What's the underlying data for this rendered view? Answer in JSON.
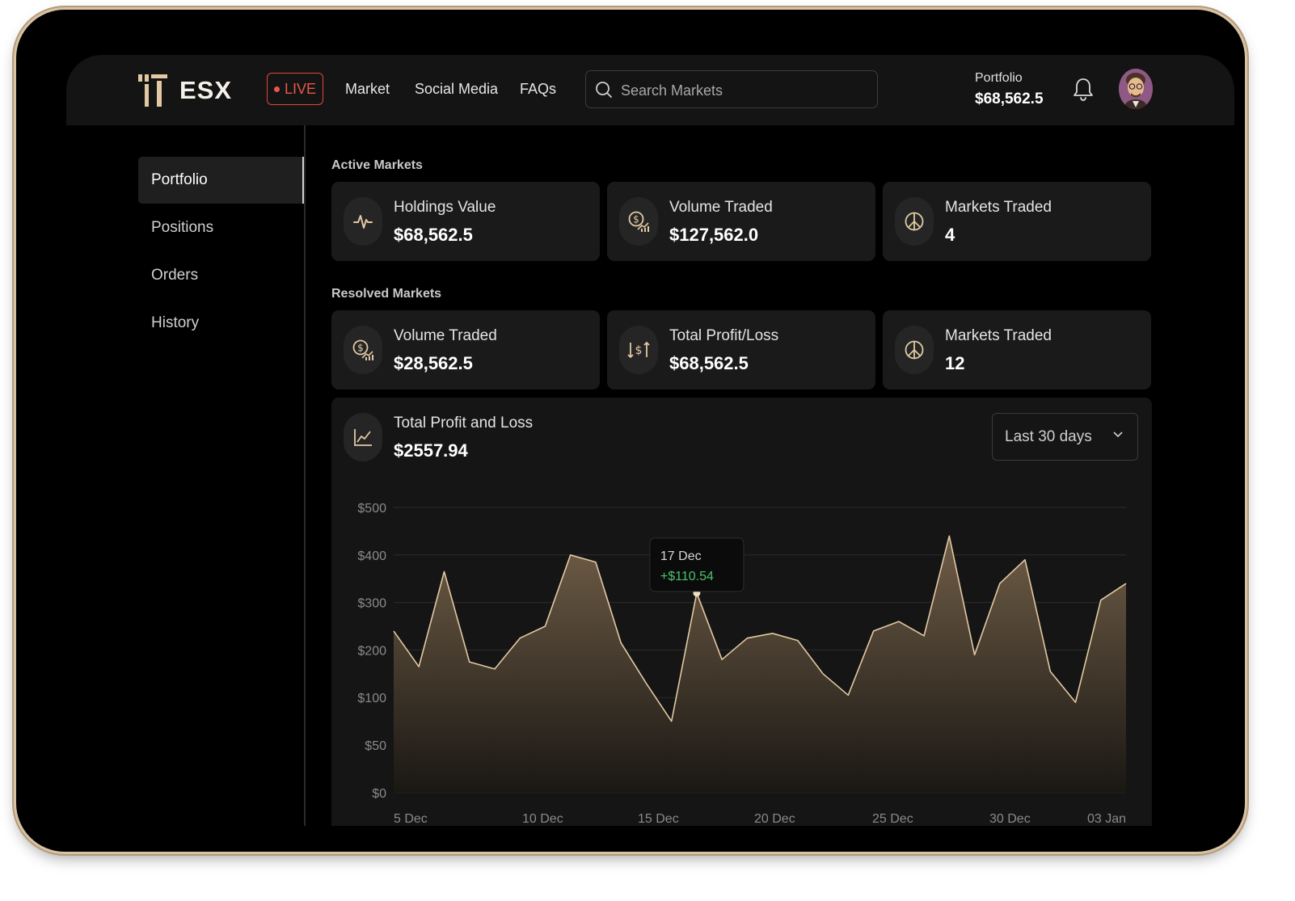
{
  "header": {
    "logo_text": "ESX",
    "live_label": "LIVE",
    "nav": [
      "Market",
      "Social Media",
      "FAQs"
    ],
    "search_placeholder": "Search Markets",
    "portfolio_label": "Portfolio",
    "portfolio_value": "$68,562.5",
    "icons": {
      "search": "search-icon",
      "notifications": "bell-icon",
      "avatar": "user-avatar"
    }
  },
  "sidebar": {
    "items": [
      {
        "label": "Portfolio",
        "active": true
      },
      {
        "label": "Positions",
        "active": false
      },
      {
        "label": "Orders",
        "active": false
      },
      {
        "label": "History",
        "active": false
      }
    ]
  },
  "active_markets": {
    "title": "Active Markets",
    "cards": [
      {
        "label": "Holdings Value",
        "value": "$68,562.5",
        "icon": "pulse-icon"
      },
      {
        "label": "Volume Traded",
        "value": "$127,562.0",
        "icon": "dollar-growth-icon"
      },
      {
        "label": "Markets Traded",
        "value": "4",
        "icon": "peace-icon"
      }
    ]
  },
  "resolved_markets": {
    "title": "Resolved Markets",
    "cards": [
      {
        "label": "Volume Traded",
        "value": "$28,562.5",
        "icon": "dollar-growth-icon"
      },
      {
        "label": "Total Profit/Loss",
        "value": "$68,562.5",
        "icon": "sort-dollar-icon"
      },
      {
        "label": "Markets Traded",
        "value": "12",
        "icon": "peace-icon"
      }
    ]
  },
  "pnl": {
    "label": "Total Profit and Loss",
    "value": "$2557.94",
    "range": "Last 30 days",
    "icon": "line-chart-icon"
  },
  "chart_data": {
    "type": "area",
    "title": "",
    "xlabel": "",
    "ylabel": "",
    "y_ticks": [
      "$0",
      "$50",
      "$100",
      "$200",
      "$300",
      "$400",
      "$500"
    ],
    "x_ticks": [
      "5 Dec",
      "10 Dec",
      "15 Dec",
      "20 Dec",
      "25 Dec",
      "30 Dec",
      "03 Jan"
    ],
    "series": [
      {
        "values": [
          240,
          165,
          365,
          175,
          160,
          225,
          250,
          400,
          385,
          215,
          130,
          75,
          320,
          180,
          225,
          235,
          220,
          150,
          105,
          240,
          260,
          230,
          440,
          190,
          340,
          390,
          155,
          95,
          305,
          340
        ]
      }
    ],
    "tooltip": {
      "date": "17 Dec",
      "value": "+$110.54",
      "index": 12
    },
    "colors": {
      "line": "#e2c9a4",
      "fill_top": "#6f5d47",
      "fill_bottom": "#1a1713",
      "positive": "#4cc26e",
      "grid": "#2c2c2c"
    }
  },
  "colors": {
    "accent": "#e2c9a4",
    "live": "#e0473b",
    "background": "#000000",
    "card": "#1a1a1a"
  }
}
